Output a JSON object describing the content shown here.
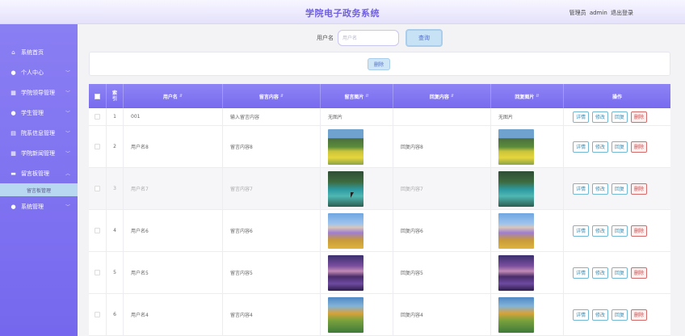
{
  "header": {
    "title": "学院电子政务系统",
    "user_label": "管理员",
    "username": "admin",
    "logout": "退出登录"
  },
  "sidebar": {
    "items": [
      {
        "label": "系统首页",
        "icon": "home-icon"
      },
      {
        "label": "个人中心",
        "icon": "user-icon"
      },
      {
        "label": "学院领导管理",
        "icon": "grid-icon"
      },
      {
        "label": "学生管理",
        "icon": "user-icon"
      },
      {
        "label": "院系信息管理",
        "icon": "doc-icon"
      },
      {
        "label": "学院新闻管理",
        "icon": "grid-icon"
      },
      {
        "label": "留言板管理",
        "icon": "mail-icon"
      },
      {
        "label": "系统管理",
        "icon": "user-icon"
      }
    ],
    "active_sub": "留言板管理"
  },
  "search": {
    "label": "用户名",
    "placeholder": "用户名",
    "button": "查询"
  },
  "actions": {
    "delete": "删除"
  },
  "table": {
    "headers": {
      "index": "索引",
      "username": "用户名",
      "content": "留言内容",
      "image": "留言图片",
      "reply": "回复内容",
      "reply_image": "回复图片",
      "ops": "操作"
    },
    "op_labels": {
      "detail": "详情",
      "edit": "修改",
      "reply": "回复",
      "delete": "删除"
    },
    "rows": [
      {
        "index": "1",
        "username": "001",
        "content": "输入留言内容",
        "image": "无图片",
        "reply": "",
        "reply_image": "无图片"
      },
      {
        "index": "2",
        "username": "用户名8",
        "content": "留言内容8",
        "image": "",
        "reply": "回复内容8",
        "reply_image": "",
        "scene": "flower"
      },
      {
        "index": "3",
        "username": "用户名7",
        "content": "留言内容7",
        "image": "",
        "reply": "回复内容7",
        "reply_image": "",
        "scene": "river"
      },
      {
        "index": "4",
        "username": "用户名6",
        "content": "留言内容6",
        "image": "",
        "reply": "回复内容6",
        "reply_image": "",
        "scene": "lavender"
      },
      {
        "index": "5",
        "username": "用户名5",
        "content": "留言内容5",
        "image": "",
        "reply": "回复内容5",
        "reply_image": "",
        "scene": "dusk"
      },
      {
        "index": "6",
        "username": "用户名4",
        "content": "留言内容4",
        "image": "",
        "reply": "回复内容4",
        "reply_image": "",
        "scene": "autumn"
      }
    ]
  },
  "colors": {
    "accent": "#7668ee",
    "title": "#6f5fe0",
    "danger": "#c84848",
    "op_border": "#72b8d4"
  }
}
